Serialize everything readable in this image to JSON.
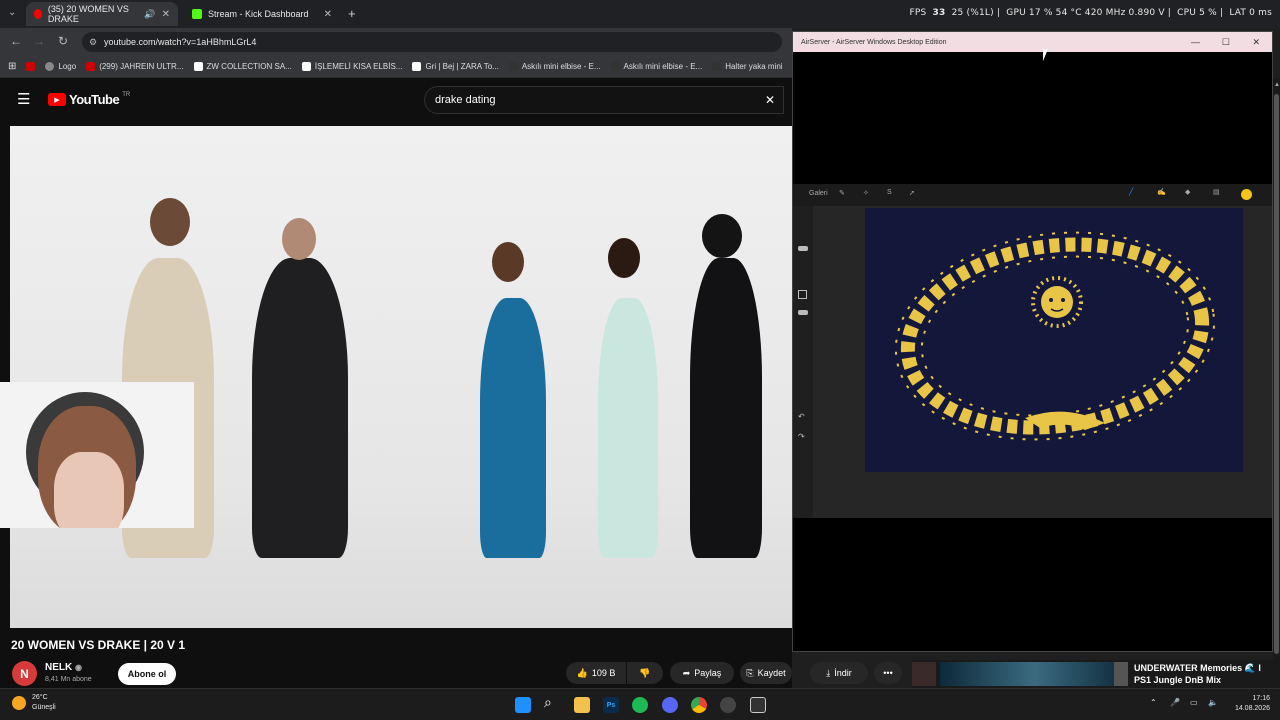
{
  "browser": {
    "tabs": [
      {
        "label": "(35) 20 WOMEN VS DRAKE",
        "close": "✕"
      },
      {
        "label": "Stream - Kick Dashboard",
        "close": "✕"
      }
    ],
    "new_tab": "+",
    "url": "youtube.com/watch?v=1aHBhmLGrL4",
    "bookmarks": [
      "Logo",
      "(299) JAHREIN ULTR...",
      "ZW COLLECTION SA...",
      "İŞLEMELİ KISA ELBİS...",
      "Gri | Bej | ZARA To...",
      "Askılı mini elbise - E...",
      "Askılı mini elbise - E...",
      "Halter yaka mini"
    ]
  },
  "hud": {
    "fps_label": "FPS",
    "fps": "33",
    "fps_pct": "25 (%1L)",
    "gpu_label": "GPU",
    "gpu": "17 % 54 °C 420 MHz 0.890 V",
    "cpu_label": "CPU",
    "cpu": "5 %",
    "clock": "LAT 0 ms"
  },
  "youtube": {
    "logo": "YouTube",
    "logo_suffix": "TR",
    "search_value": "drake dating",
    "clear": "✕",
    "video_title": "20 WOMEN VS DRAKE | 20 V 1",
    "channel_initial": "N",
    "channel_name": "NELK",
    "subscribers": "8,41 Mn abone",
    "subscribe": "Abone ol",
    "likes": "109 B",
    "share": "Paylaş",
    "save": "Kaydet",
    "download": "İndir",
    "more": "•••"
  },
  "airserver": {
    "title": "AirServer - AirServer Windows Desktop Edition",
    "gallery": "Galeri"
  },
  "media": {
    "title": "UNDERWATER Memories 🌊 I",
    "subtitle": "PS1 Jungle DnB Mix"
  },
  "taskbar": {
    "weather_temp": "26°C",
    "weather_desc": "Güneşli",
    "time": "17:16",
    "date": "14.08.2026"
  },
  "colors": {
    "accent_red": "#ff0000",
    "art_gold": "#e8c547",
    "art_bg": "#13183a"
  }
}
